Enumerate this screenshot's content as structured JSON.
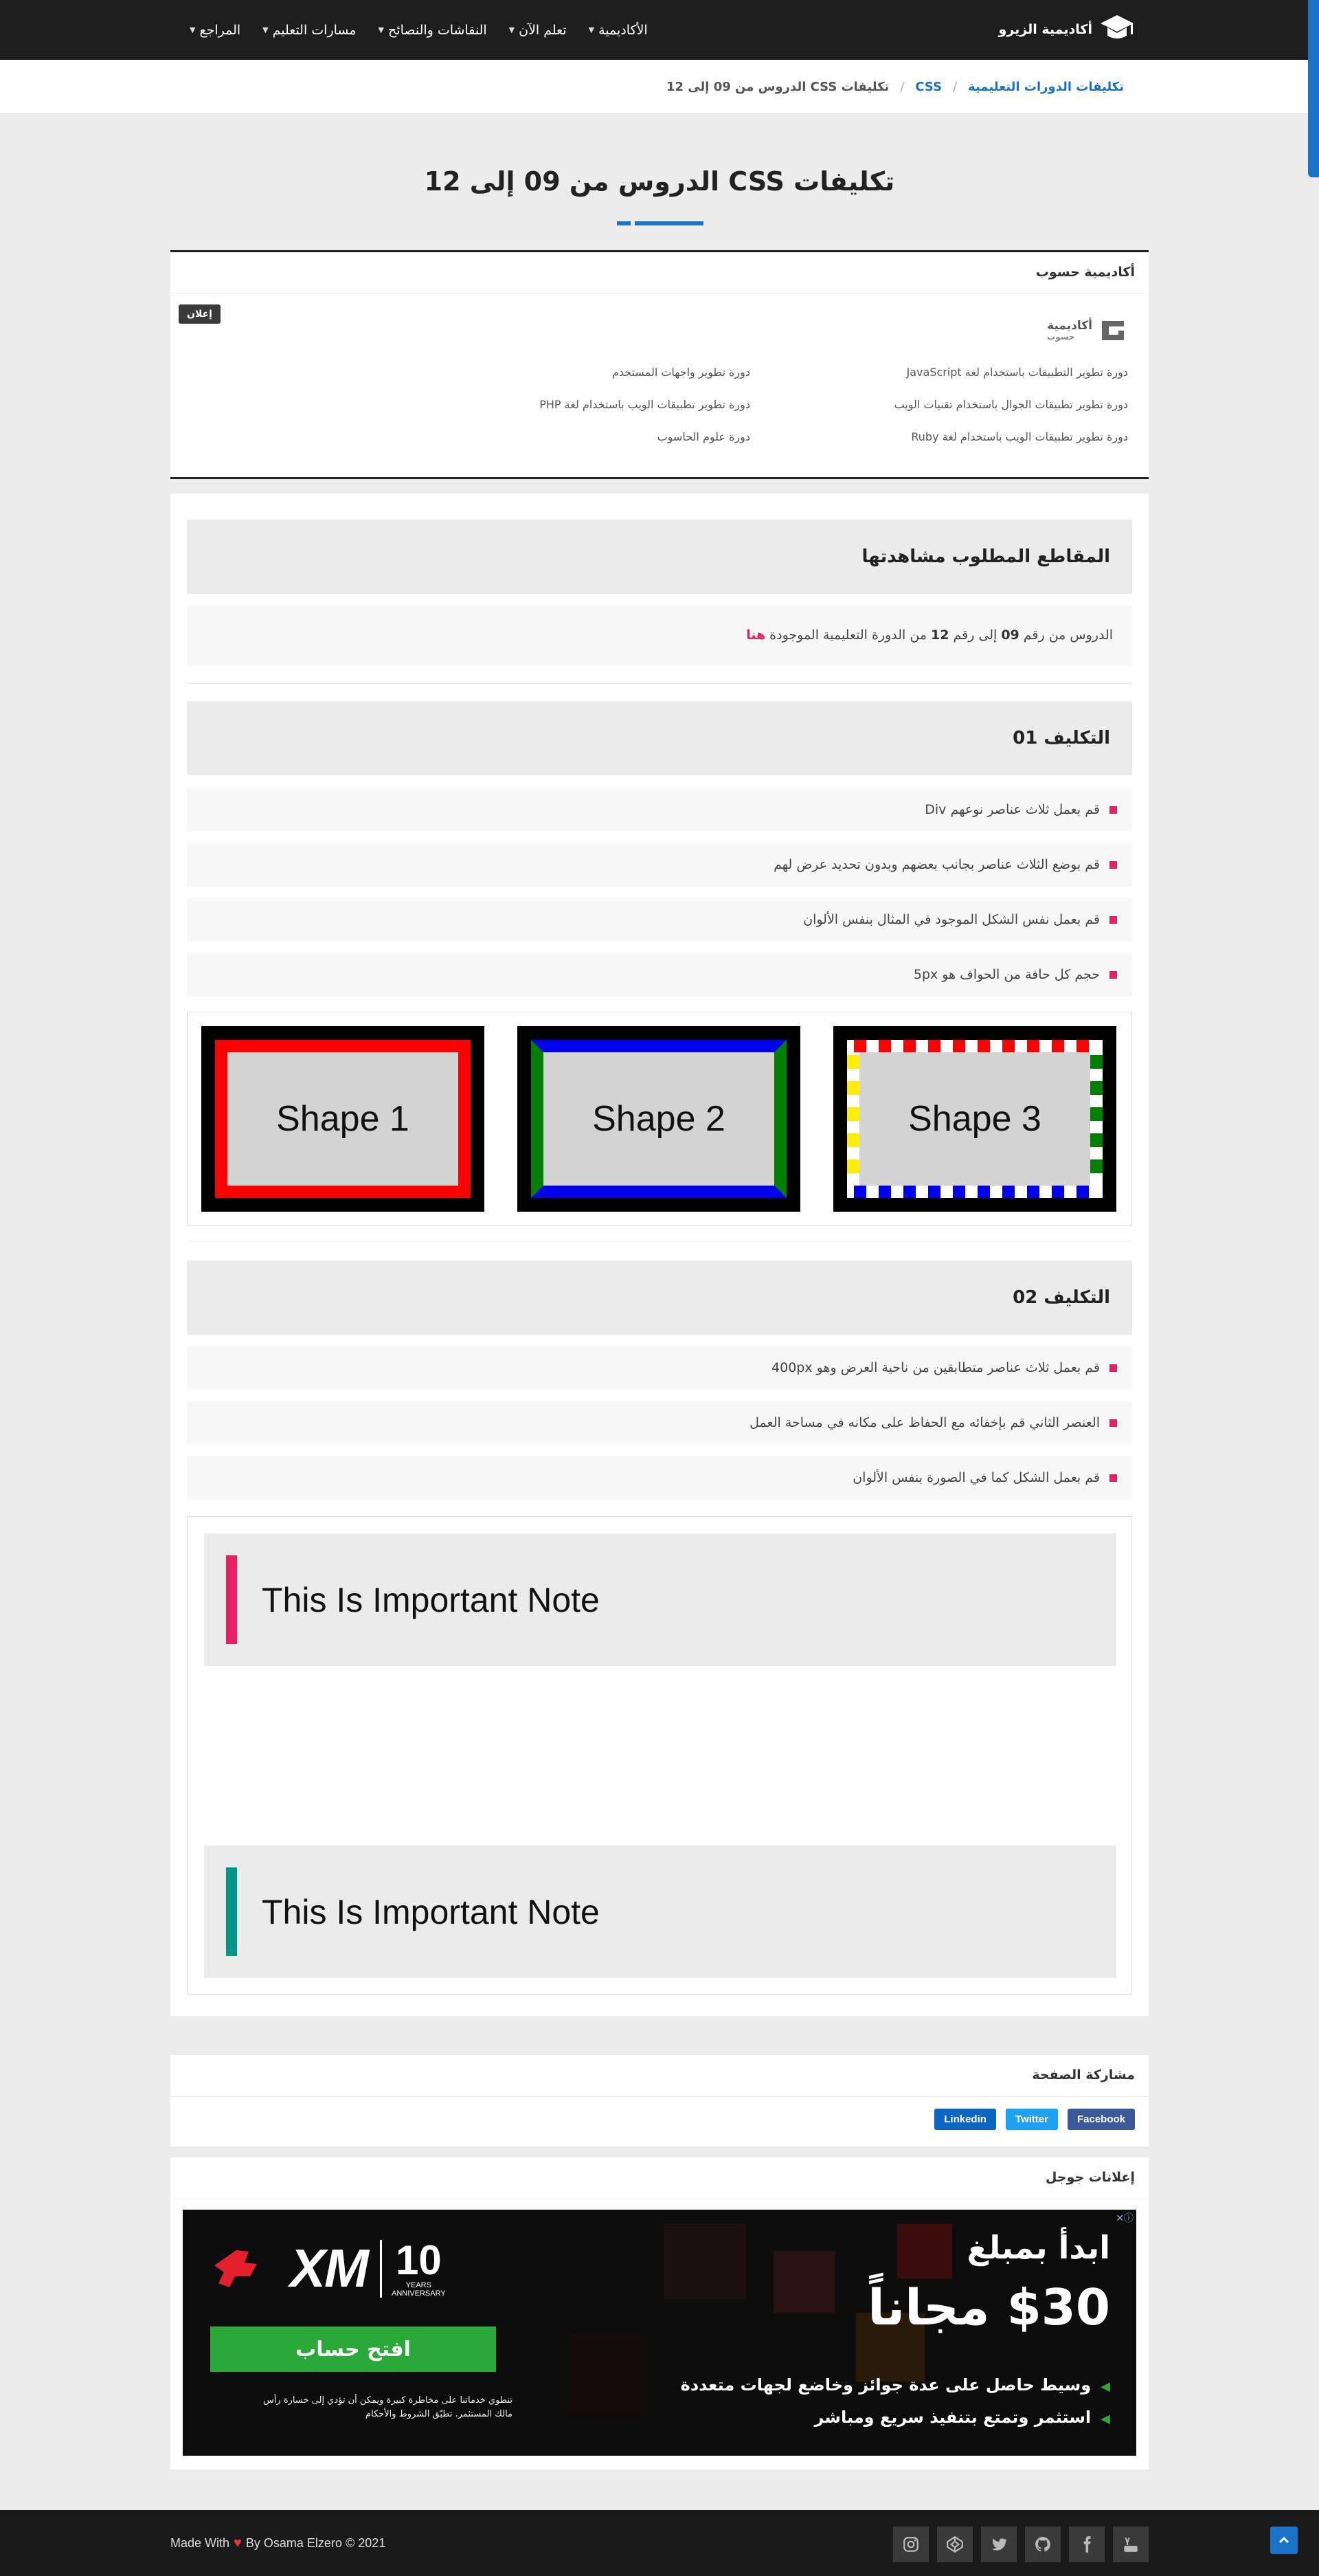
{
  "nav": {
    "logo_text": "أكاديمية الزيرو",
    "items": [
      "الأكاديمية",
      "تعلم الآن",
      "النقاشات والنصائح",
      "مسارات التعليم",
      "المراجع"
    ]
  },
  "breadcrumb": {
    "root": "تكليفات الدورات التعليمية",
    "section": "CSS",
    "current": "تكليفات CSS الدروس من 09 إلى 12"
  },
  "page_title": "تكليفات CSS الدروس من 09 إلى 12",
  "sponsor": {
    "heading": "أكاديمية حسوب",
    "ad_badge": "إعلان",
    "logo_main": "أكاديمية",
    "logo_sub": "حسوب",
    "courses": [
      "دورة تطوير التطبيقات باستخدام لغة JavaScript",
      "دورة تطوير واجهات المستخدم",
      "دورة تطوير تطبيقات الجوال باستخدام تقنيات الويب",
      "دورة تطوير تطبيقات الويب باستخدام لغة PHP",
      "دورة تطوير تطبيقات الويب باستخدام لغة Ruby",
      "دورة علوم الحاسوب"
    ]
  },
  "videos": {
    "heading": "المقاطع المطلوب مشاهدتها",
    "pre": "الدروس من رقم",
    "from": "09",
    "mid": "إلى رقم",
    "to": "12",
    "post": "من الدورة التعليمية الموجودة",
    "link": "هنا"
  },
  "task1": {
    "heading": "التكليف 01",
    "items": [
      "قم بعمل ثلاث عناصر نوعهم Div",
      "قم بوضع الثلاث عناصر بجانب بعضهم وبدون تحديد عرض لهم",
      "قم بعمل نفس الشكل الموجود في المثال بنفس الألوان",
      "حجم كل حافة من الحواف هو 5px"
    ],
    "shapes": [
      "Shape 1",
      "Shape 2",
      "Shape 3"
    ]
  },
  "task2": {
    "heading": "التكليف 02",
    "items": [
      "قم بعمل ثلاث عناصر متطابقين من ناحية العرض وهو 400px",
      "العنصر الثاني قم بإخفائه مع الحفاظ على مكانه في مساحة العمل",
      "قم بعمل الشكل كما في الصورة بنفس الألوان"
    ],
    "notes": [
      "This Is Important Note",
      "This Is Important Note"
    ],
    "note_colors": [
      "#e91e63",
      "#009688"
    ]
  },
  "share": {
    "heading": "مشاركة الصفحة",
    "buttons": [
      "Facebook",
      "Twitter",
      "Linkedin"
    ],
    "colors": [
      "#3b5998",
      "#1da1f2",
      "#0a66c2"
    ]
  },
  "google_ads": {
    "heading": "إعلانات جوجل",
    "brand": "XM",
    "years": "10",
    "years_label": "YEARS",
    "anniversary": "ANNIVERSARY",
    "open_account": "افتح حساب",
    "risk_line1": "تنطوي خدماتنا على مخاطرة كبيرة ويمكن أن تؤدي إلى خسارة رأس",
    "risk_line2": "مالك المستثمر. تطبّق الشروط والأحكام",
    "headline1": "ابدأ بمبلغ",
    "headline2": "$30 مجاناً",
    "bullets": [
      "وسيط حاصل على عدة جوائز وخاضع لجهات متعددة",
      "استثمر وتمتع بتنفيذ سريع ومباشر"
    ]
  },
  "footer": {
    "made_with": "Made With",
    "by": "By Osama Elzero © 2021",
    "socials": [
      "youtube-icon",
      "facebook-icon",
      "github-icon",
      "twitter-icon",
      "codepen-icon",
      "instagram-icon"
    ]
  }
}
